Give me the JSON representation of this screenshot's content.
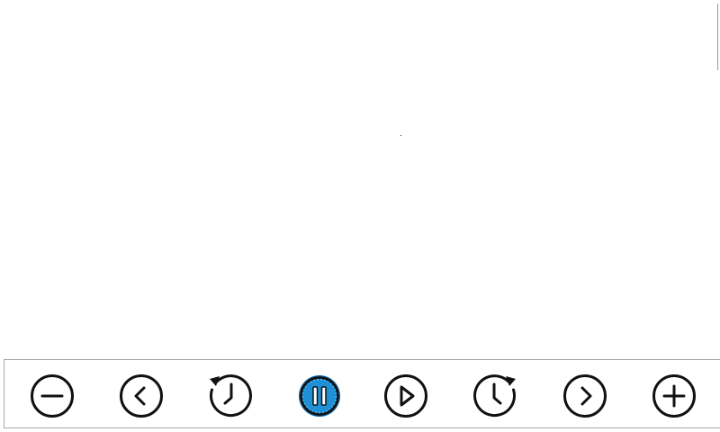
{
  "controls": [
    {
      "id": "zoom_out",
      "icon": "minus-circle-icon",
      "label": "Zoom out"
    },
    {
      "id": "previous",
      "icon": "chevron-left-circle-icon",
      "label": "Previous"
    },
    {
      "id": "rewind",
      "icon": "rewind-clock-icon",
      "label": "Rewind"
    },
    {
      "id": "pause",
      "icon": "pause-circle-icon",
      "label": "Pause",
      "active": true
    },
    {
      "id": "play",
      "icon": "play-circle-icon",
      "label": "Play"
    },
    {
      "id": "fast_forward",
      "icon": "forward-clock-icon",
      "label": "Fast forward"
    },
    {
      "id": "next",
      "icon": "chevron-right-circle-icon",
      "label": "Next"
    },
    {
      "id": "zoom_in",
      "icon": "plus-circle-icon",
      "label": "Zoom in"
    }
  ],
  "colors": {
    "stroke": "#111111",
    "active_fill": "#1e90d8",
    "active_stroke": "#0d5fa0",
    "toolbar_border": "#a8a8a8",
    "background": "#ffffff"
  }
}
